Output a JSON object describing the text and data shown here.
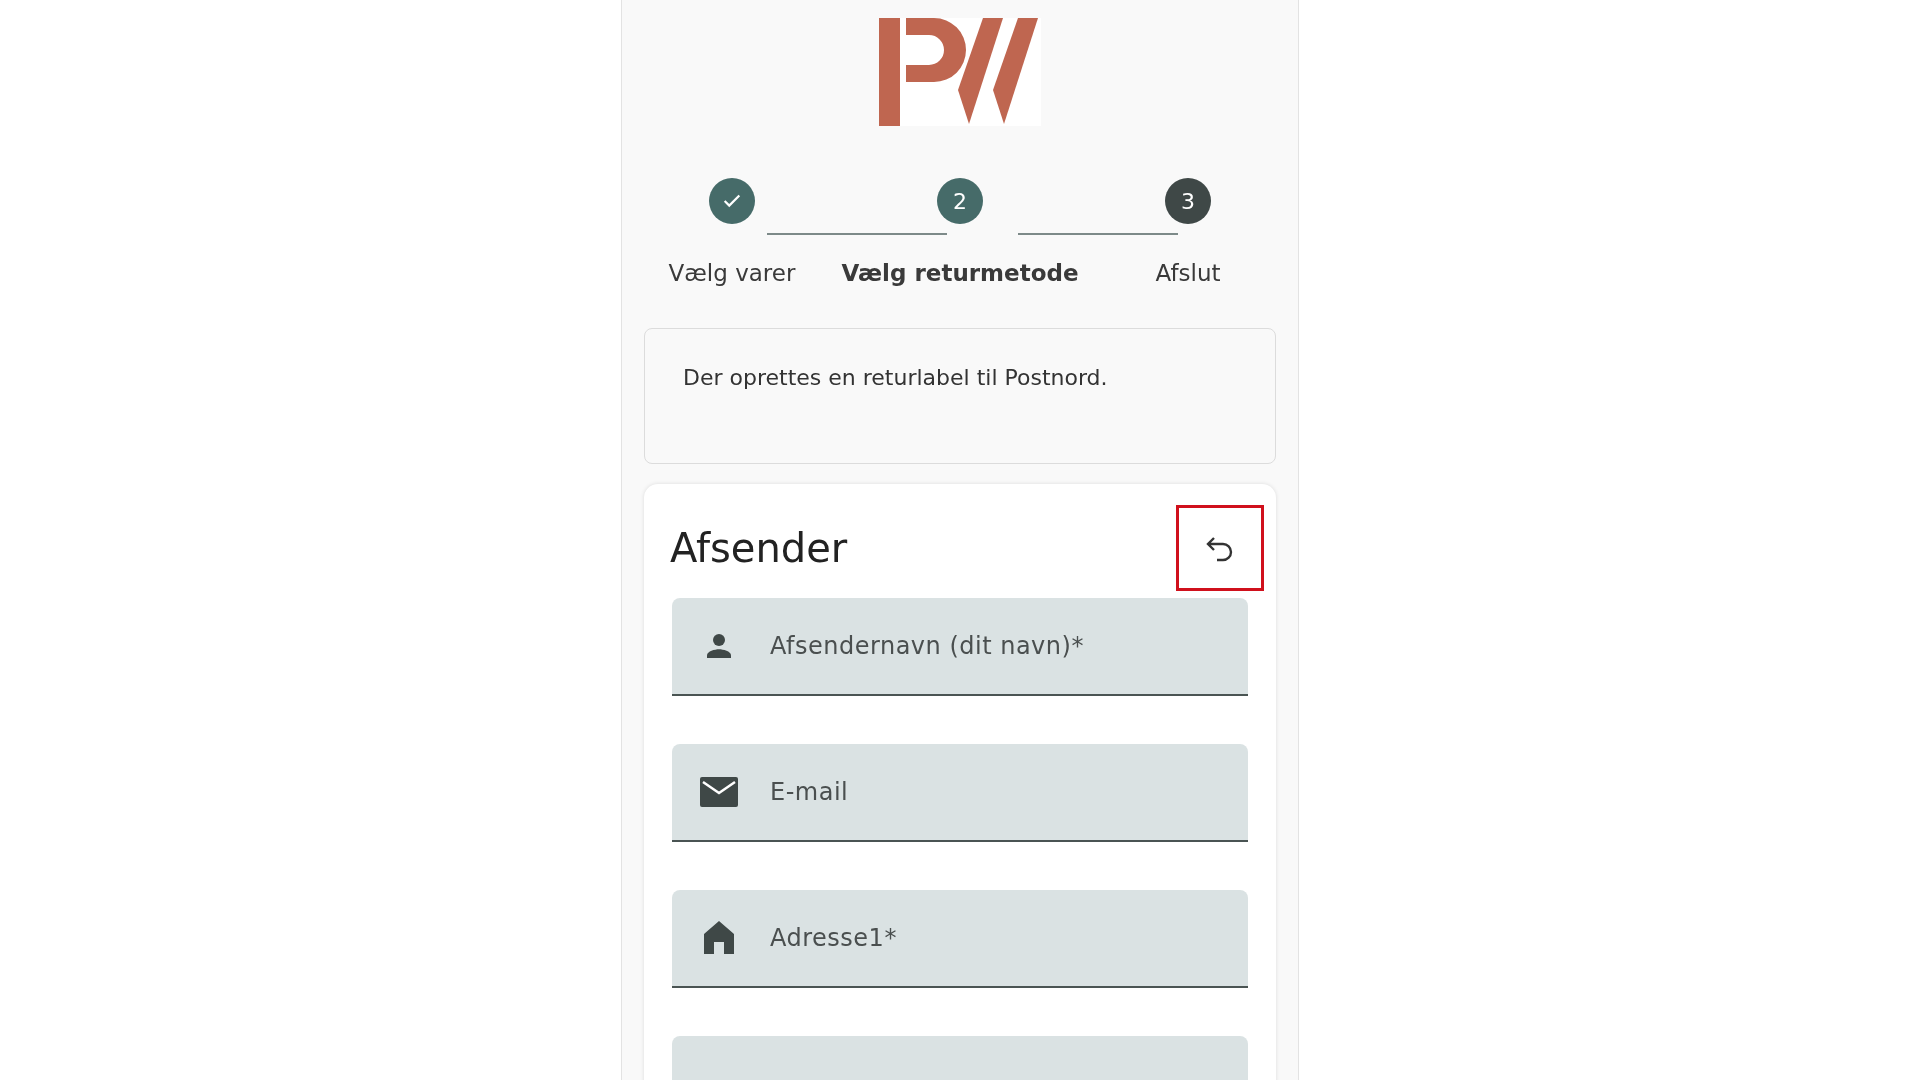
{
  "steps": [
    {
      "label": "Vælg varer",
      "completed": true,
      "selected": false
    },
    {
      "number": "2",
      "label": "Vælg returmetode",
      "completed": false,
      "selected": true
    },
    {
      "number": "3",
      "label": "Afslut",
      "completed": false,
      "selected": false
    }
  ],
  "info": {
    "text": "Der oprettes en returlabel til Postnord."
  },
  "sender": {
    "title": "Afsender",
    "reset_highlighted": true,
    "fields": [
      {
        "kind": "person",
        "placeholder": "Afsendernavn (dit navn)*"
      },
      {
        "kind": "email",
        "placeholder": "E-mail"
      },
      {
        "kind": "home",
        "placeholder": "Adresse1*"
      },
      {
        "kind": "plain"
      }
    ]
  }
}
